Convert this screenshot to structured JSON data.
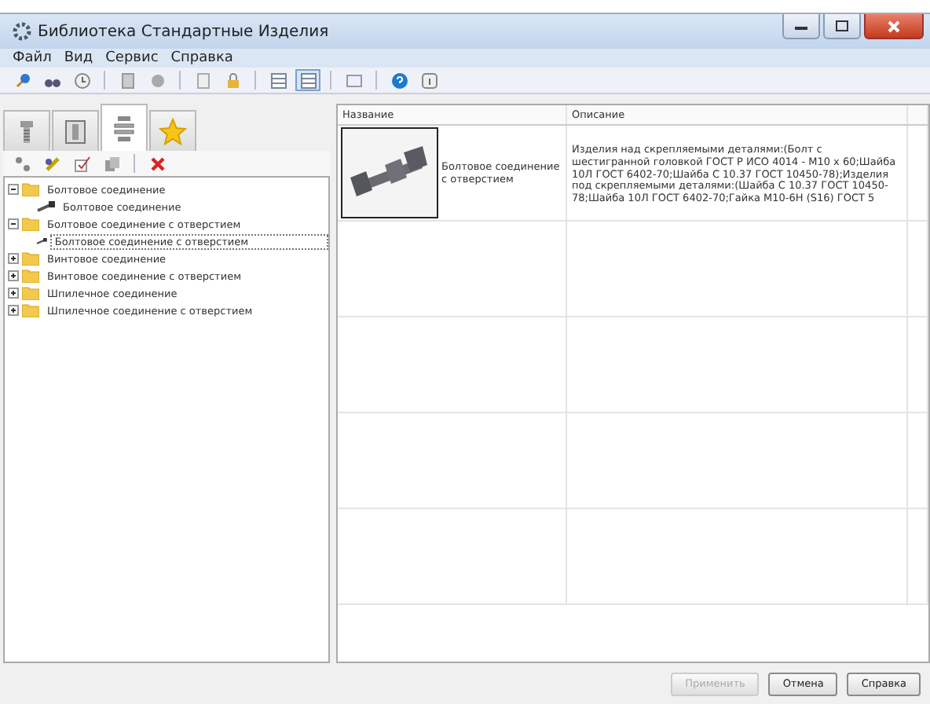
{
  "window": {
    "title": "Библиотека Стандартные Изделия"
  },
  "menu": [
    "Файл",
    "Вид",
    "Сервис",
    "Справка"
  ],
  "toolbar": [
    {
      "kind": "pin",
      "selected": false
    },
    {
      "kind": "binoculars",
      "selected": false
    },
    {
      "kind": "clock",
      "selected": false
    },
    {
      "kind": "sep"
    },
    {
      "kind": "doc",
      "selected": false
    },
    {
      "kind": "disk",
      "selected": false
    },
    {
      "kind": "sep"
    },
    {
      "kind": "page",
      "selected": false
    },
    {
      "kind": "lock",
      "selected": false
    },
    {
      "kind": "sep"
    },
    {
      "kind": "grid",
      "selected": false
    },
    {
      "kind": "grid",
      "selected": true
    },
    {
      "kind": "sep"
    },
    {
      "kind": "panel",
      "selected": false
    },
    {
      "kind": "sep"
    },
    {
      "kind": "help",
      "selected": false
    },
    {
      "kind": "info",
      "selected": false
    }
  ],
  "tabs": [
    {
      "kind": "bolt",
      "selected": false
    },
    {
      "kind": "box",
      "selected": false
    },
    {
      "kind": "washers",
      "selected": true
    },
    {
      "kind": "star",
      "selected": false
    }
  ],
  "actions": [
    {
      "kind": "link"
    },
    {
      "kind": "pen"
    },
    {
      "kind": "check"
    },
    {
      "kind": "copy"
    },
    {
      "kind": "sep"
    },
    {
      "kind": "delete"
    }
  ],
  "tree": [
    {
      "label": "Болтовое соединение",
      "expanded": true,
      "children": [
        {
          "label": "Болтовое соединение",
          "selected": false
        }
      ]
    },
    {
      "label": "Болтовое соединение с отверстием",
      "expanded": true,
      "children": [
        {
          "label": "Болтовое соединение с отверстием",
          "selected": true
        }
      ]
    },
    {
      "label": "Винтовое соединение",
      "expanded": false
    },
    {
      "label": "Винтовое соединение с отверстием",
      "expanded": false
    },
    {
      "label": "Шпилечное соединение",
      "expanded": false
    },
    {
      "label": "Шпилечное соединение с отверстием",
      "expanded": false
    }
  ],
  "table": {
    "columns": [
      "Название",
      "Описание"
    ],
    "rows": [
      {
        "name": "Болтовое соединение с отверстием",
        "description": "Изделия над скрепляемыми деталями:(Болт с шестигранной головкой ГОСТ Р ИСО 4014 - М10 x 60;Шайба 10Л ГОСТ 6402-70;Шайба С 10.37 ГОСТ 10450-78);Изделия под скрепляемыми деталями:(Шайба С 10.37 ГОСТ 10450-78;Шайба 10Л ГОСТ 6402-70;Гайка М10-6Н (S16) ГОСТ 5"
      }
    ]
  },
  "buttons": [
    {
      "label": "Применить",
      "disabled": true
    },
    {
      "label": "Отмена",
      "disabled": false
    },
    {
      "label": "Справка",
      "disabled": false
    }
  ]
}
